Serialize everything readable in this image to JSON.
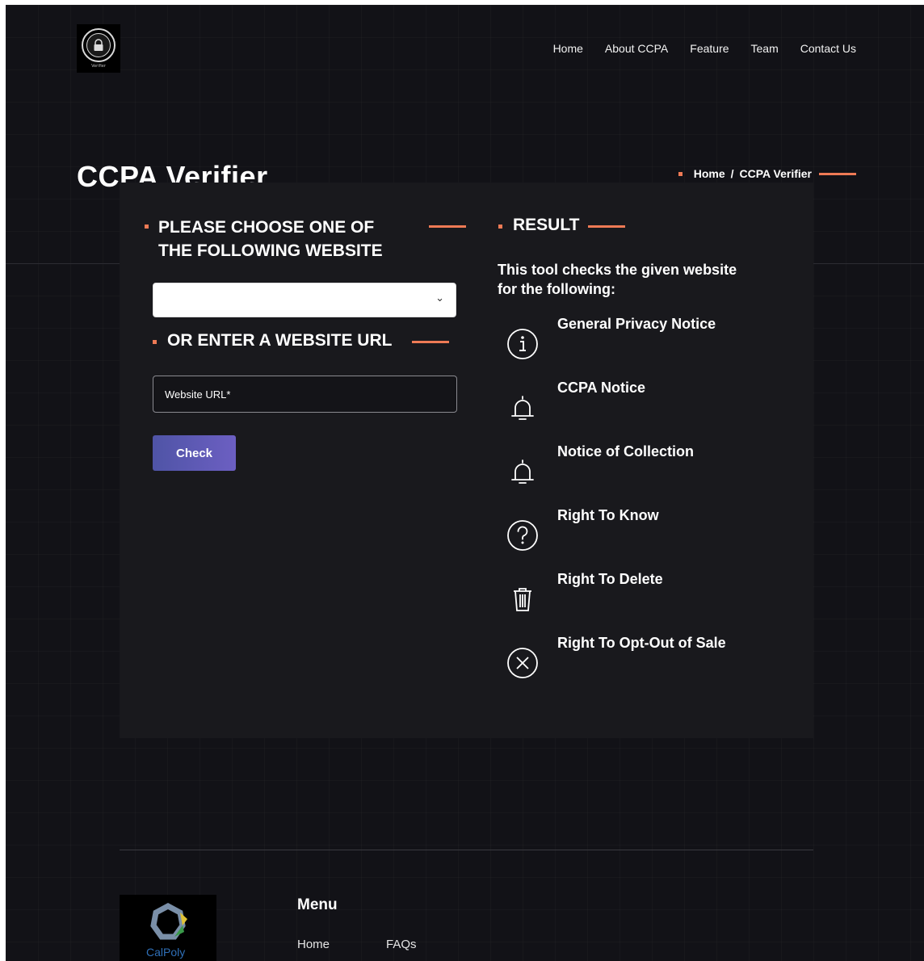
{
  "header": {
    "logo_caption": "Verifier",
    "nav": [
      "Home",
      "About CCPA",
      "Feature",
      "Team",
      "Contact Us"
    ]
  },
  "page_title": "CCPA Verifier",
  "breadcrumb": {
    "home": "Home",
    "separator": "/",
    "current": "CCPA Verifier"
  },
  "form": {
    "choose_heading_line1": "PLEASE CHOOSE ONE OF",
    "choose_heading_line2": "THE FOLLOWING WEBSITE",
    "select_value": "",
    "enter_heading": "OR ENTER A WEBSITE URL",
    "url_placeholder": "Website URL*",
    "check_label": "Check"
  },
  "result": {
    "heading": "RESULT",
    "description": "This tool checks the given website for the following:",
    "features": [
      {
        "label": "General Privacy Notice",
        "icon": "info-icon"
      },
      {
        "label": "CCPA Notice",
        "icon": "bell-icon"
      },
      {
        "label": "Notice of Collection",
        "icon": "bell-icon"
      },
      {
        "label": "Right To Know",
        "icon": "question-icon"
      },
      {
        "label": "Right To Delete",
        "icon": "trash-icon"
      },
      {
        "label": "Right To Opt-Out of Sale",
        "icon": "close-circle-icon"
      }
    ]
  },
  "footer": {
    "logo_text": "CalPoly",
    "menu_heading": "Menu",
    "links": [
      "Home",
      "FAQs"
    ]
  },
  "colors": {
    "accent": "#ee7a55",
    "background": "#121217",
    "panel": "#19191d",
    "button": "#5a58b4"
  }
}
